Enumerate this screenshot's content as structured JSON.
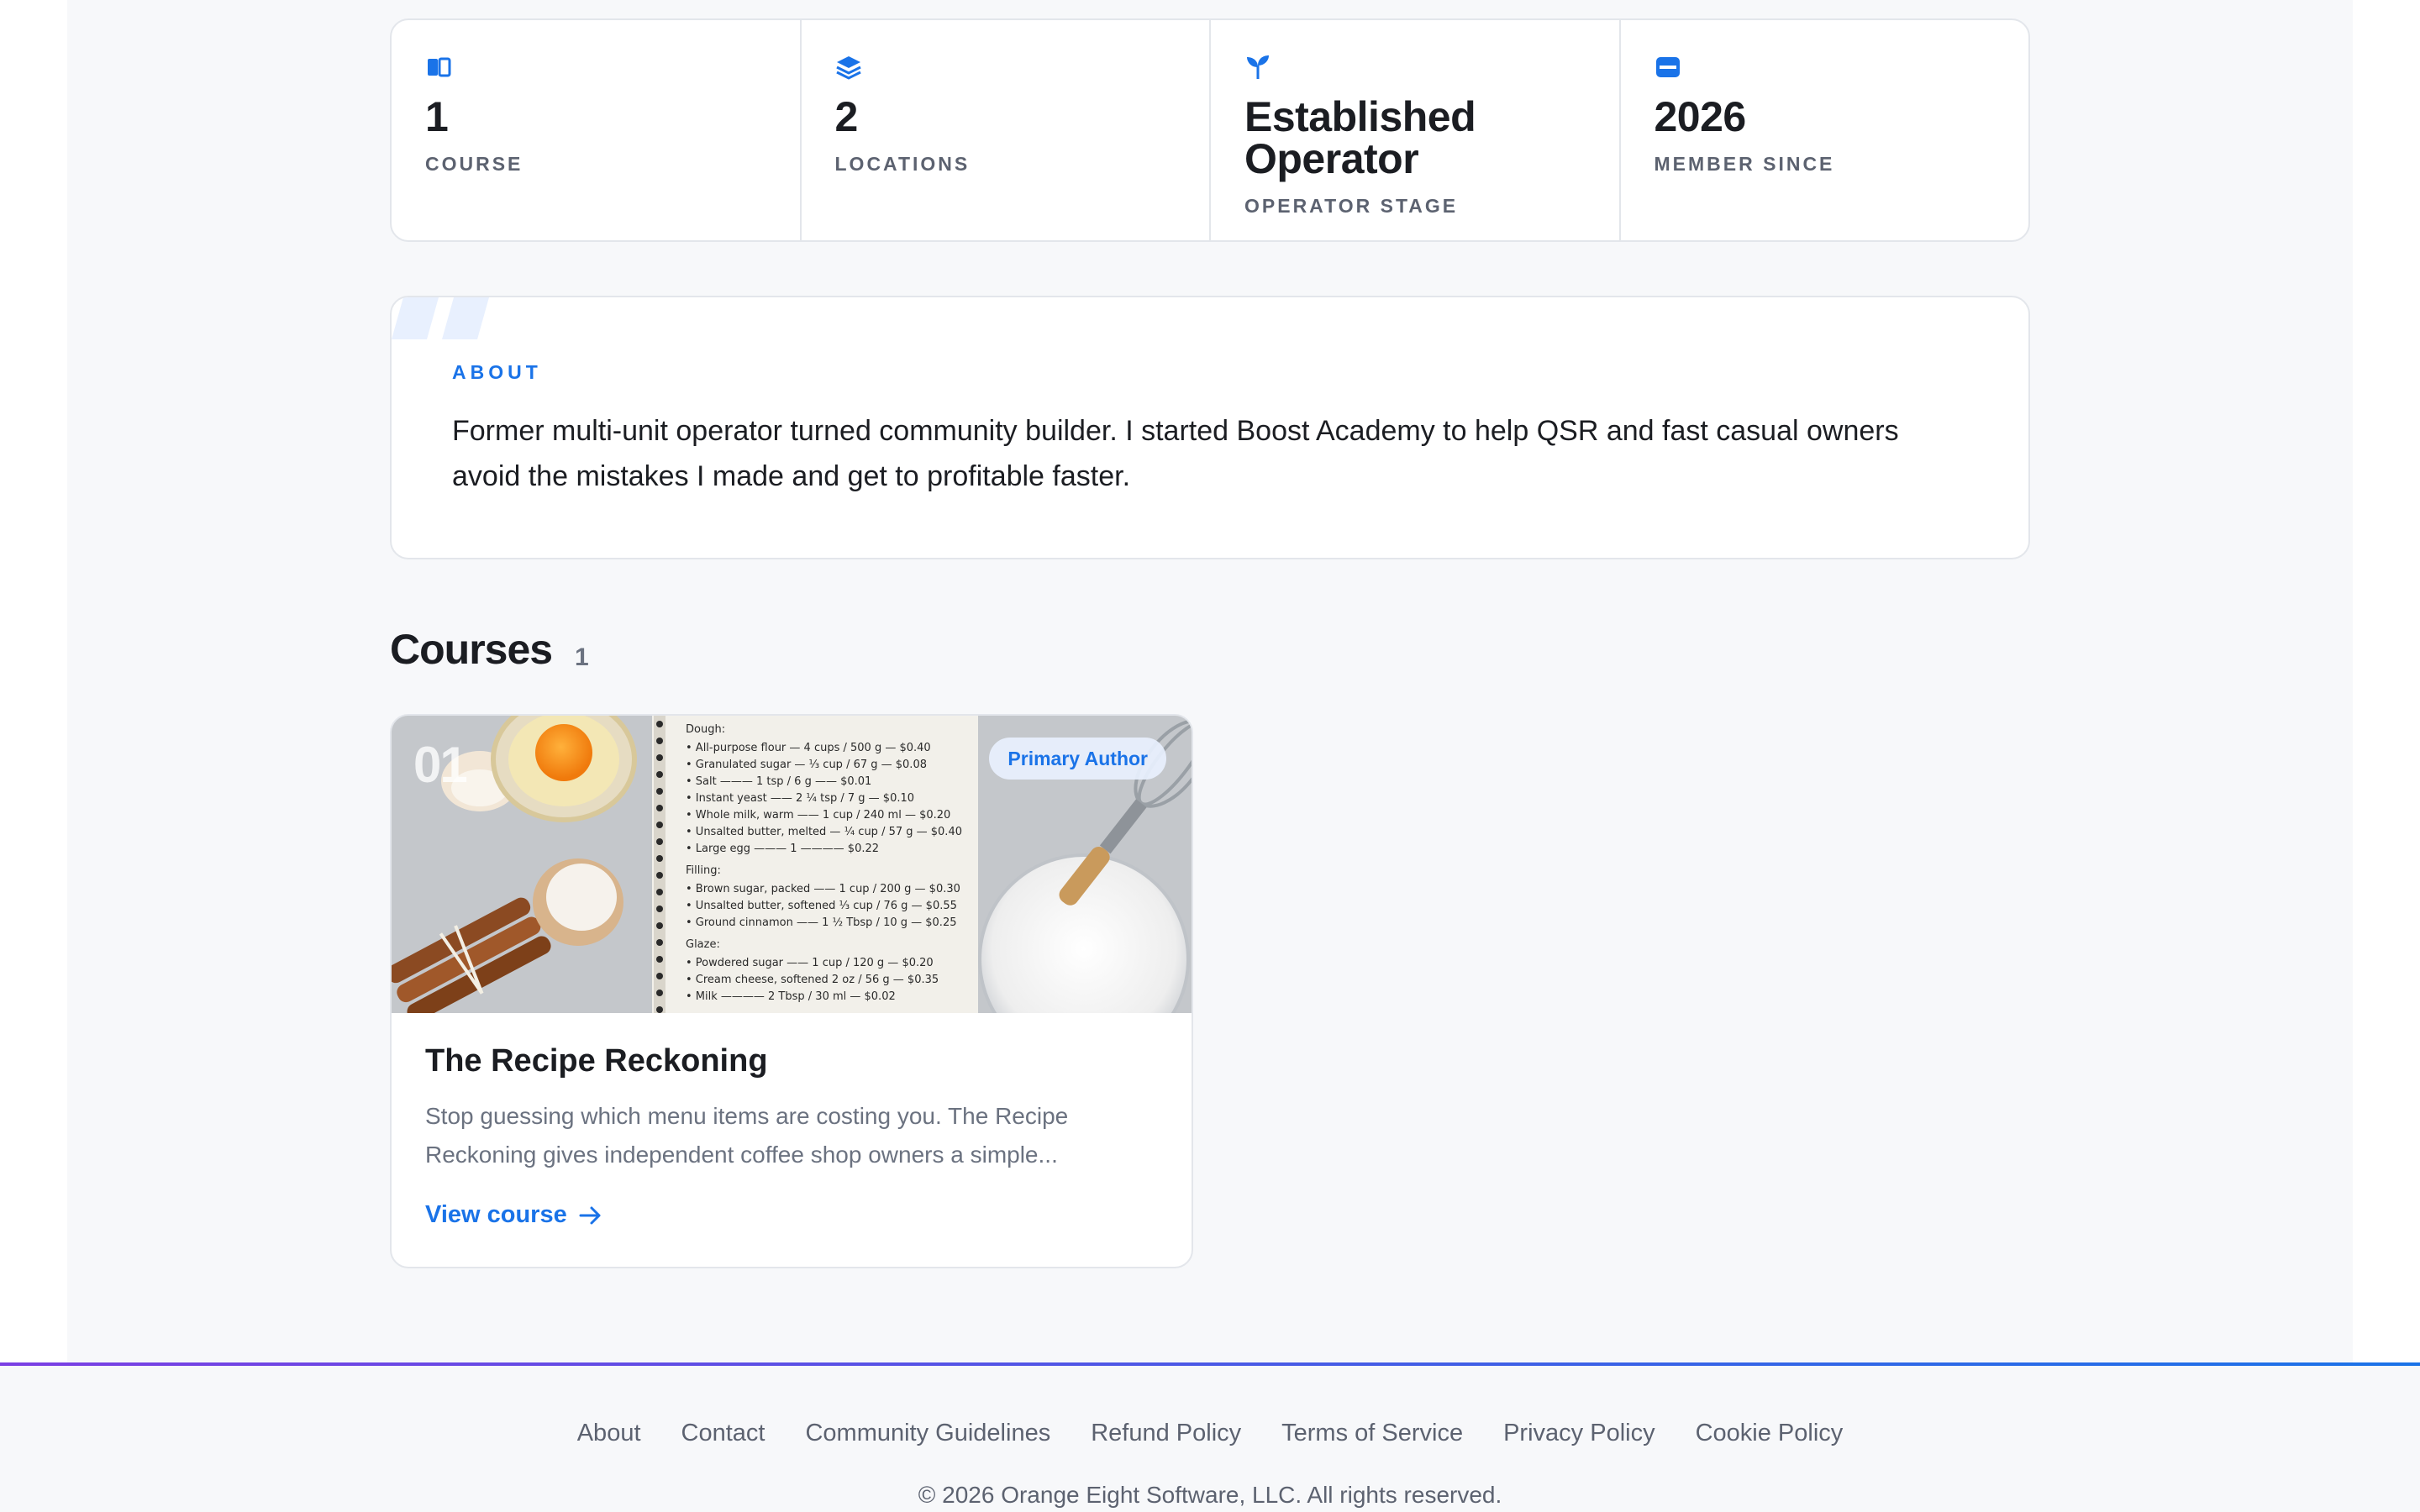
{
  "stats": [
    {
      "icon": "book-icon",
      "value": "1",
      "label": "COURSE"
    },
    {
      "icon": "layers-icon",
      "value": "2",
      "label": "LOCATIONS"
    },
    {
      "icon": "sprout-icon",
      "value": "Established\nOperator",
      "label": "OPERATOR STAGE"
    },
    {
      "icon": "store-icon",
      "value": "2026",
      "label": "MEMBER SINCE"
    }
  ],
  "about": {
    "heading": "ABOUT",
    "bio": "Former multi-unit operator turned community builder. I started Boost Academy to help QSR and fast casual owners avoid the mistakes I made and get to profitable faster."
  },
  "courses": {
    "title": "Courses",
    "count": "1",
    "items": [
      {
        "number": "01",
        "badge": "Primary Author",
        "title": "The Recipe Reckoning",
        "description": "Stop guessing which menu items are costing you. The Recipe Reckoning gives independent coffee shop owners a simple...",
        "cta": "View course",
        "notebook": {
          "dough_heading": "Dough:",
          "dough": [
            "• All-purpose flour — 4 cups / 500 g — $0.40",
            "• Granulated sugar — ⅓ cup / 67 g — $0.08",
            "• Salt ——— 1 tsp / 6 g —— $0.01",
            "• Instant yeast —— 2 ¼ tsp / 7 g — $0.10",
            "• Whole milk, warm —— 1 cup / 240 ml — $0.20",
            "• Unsalted butter, melted — ¼ cup / 57 g — $0.40",
            "• Large egg ——— 1 ———— $0.22"
          ],
          "filling_heading": "Filling:",
          "filling": [
            "• Brown sugar, packed —— 1 cup / 200 g — $0.30",
            "• Unsalted butter, softened ⅓ cup / 76 g — $0.55",
            "• Ground cinnamon —— 1 ½ Tbsp / 10 g — $0.25"
          ],
          "glaze_heading": "Glaze:",
          "glaze": [
            "• Powdered sugar —— 1 cup / 120 g — $0.20",
            "• Cream cheese, softened 2 oz / 56 g — $0.35",
            "• Milk ———— 2 Tbsp / 30 ml — $0.02"
          ]
        }
      }
    ]
  },
  "footer": {
    "links": [
      "About",
      "Contact",
      "Community Guidelines",
      "Refund Policy",
      "Terms of Service",
      "Privacy Policy",
      "Cookie Policy"
    ],
    "copyright": "© 2026 Orange Eight Software, LLC. All rights reserved."
  },
  "colors": {
    "accent": "#1a73e8",
    "text": "#1b1d22",
    "muted": "#6b7280"
  }
}
